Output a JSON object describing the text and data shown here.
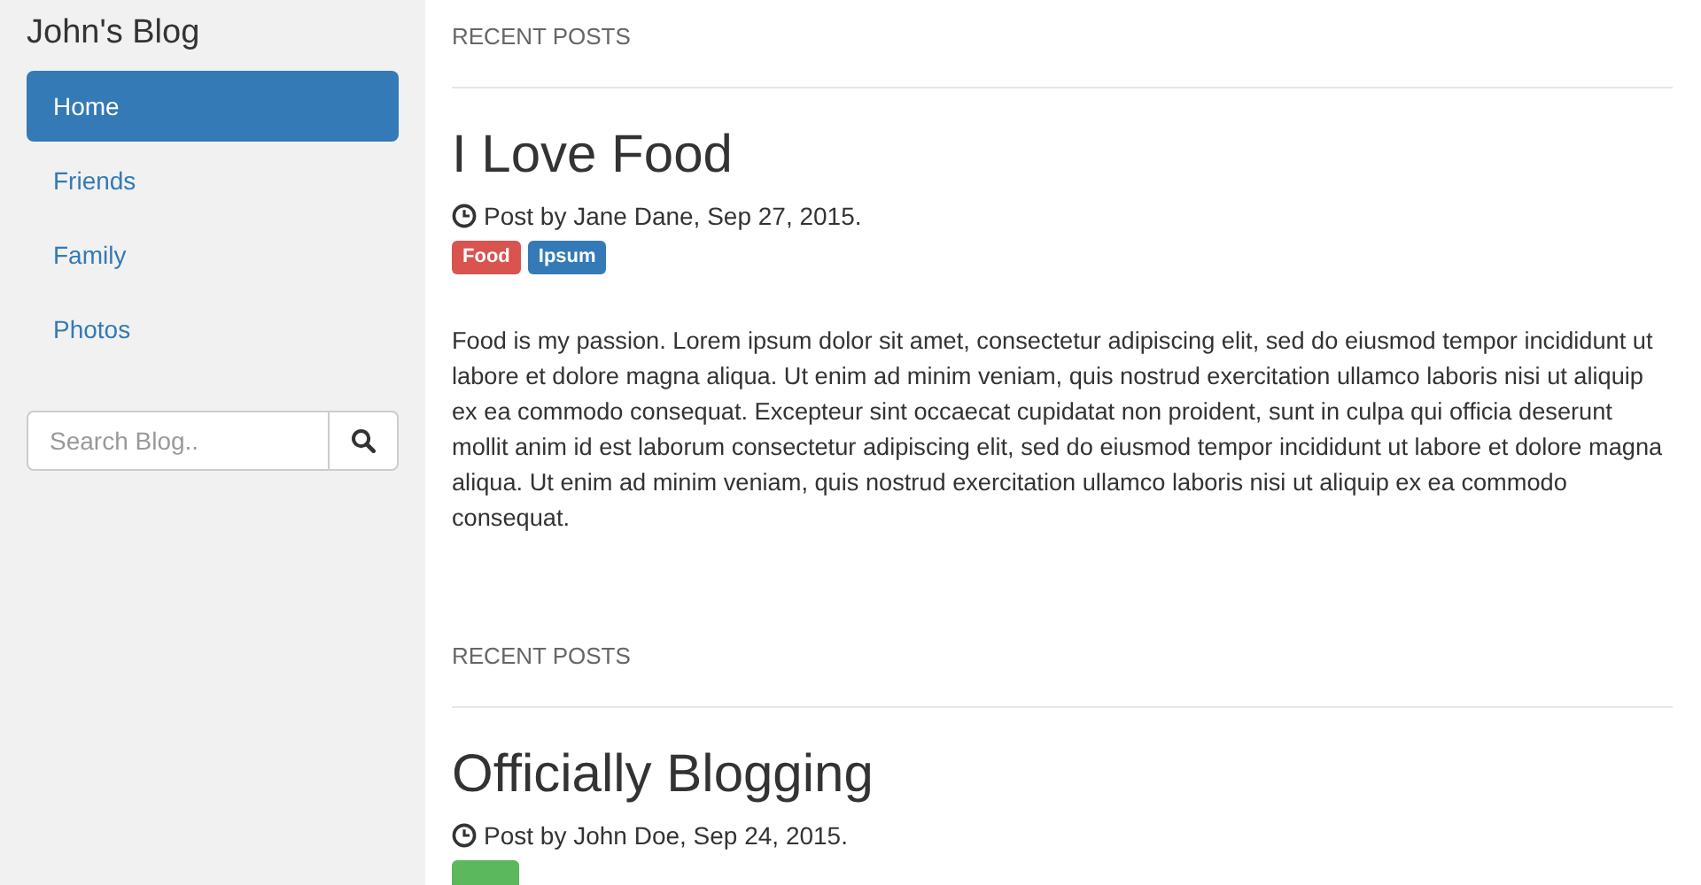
{
  "sidebar": {
    "title": "John's Blog",
    "nav": [
      {
        "label": "Home",
        "selected": true
      },
      {
        "label": "Friends",
        "selected": false
      },
      {
        "label": "Family",
        "selected": false
      },
      {
        "label": "Photos",
        "selected": false
      }
    ],
    "search": {
      "placeholder": "Search Blog.."
    }
  },
  "posts": [
    {
      "section": "RECENT POSTS",
      "title": "I Love Food",
      "byline": "Post by Jane Dane, Sep 27, 2015.",
      "tags": [
        {
          "label": "Food",
          "color": "#d9534f"
        },
        {
          "label": "Ipsum",
          "color": "#337ab7"
        }
      ],
      "body": "Food is my passion. Lorem ipsum dolor sit amet, consectetur adipiscing elit, sed do eiusmod tempor incididunt ut labore et dolore magna aliqua. Ut enim ad minim veniam, quis nostrud exercitation ullamco laboris nisi ut aliquip ex ea commodo consequat. Excepteur sint occaecat cupidatat non proident, sunt in culpa qui officia deserunt mollit anim id est laborum consectetur adipiscing elit, sed do eiusmod tempor incididunt ut labore et dolore magna aliqua. Ut enim ad minim veniam, quis nostrud exercitation ullamco laboris nisi ut aliquip ex ea commodo consequat."
    },
    {
      "section": "RECENT POSTS",
      "title": "Officially Blogging",
      "byline": "Post by John Doe, Sep 24, 2015.",
      "tags": [
        {
          "color": "#5cb85c"
        }
      ]
    }
  ]
}
